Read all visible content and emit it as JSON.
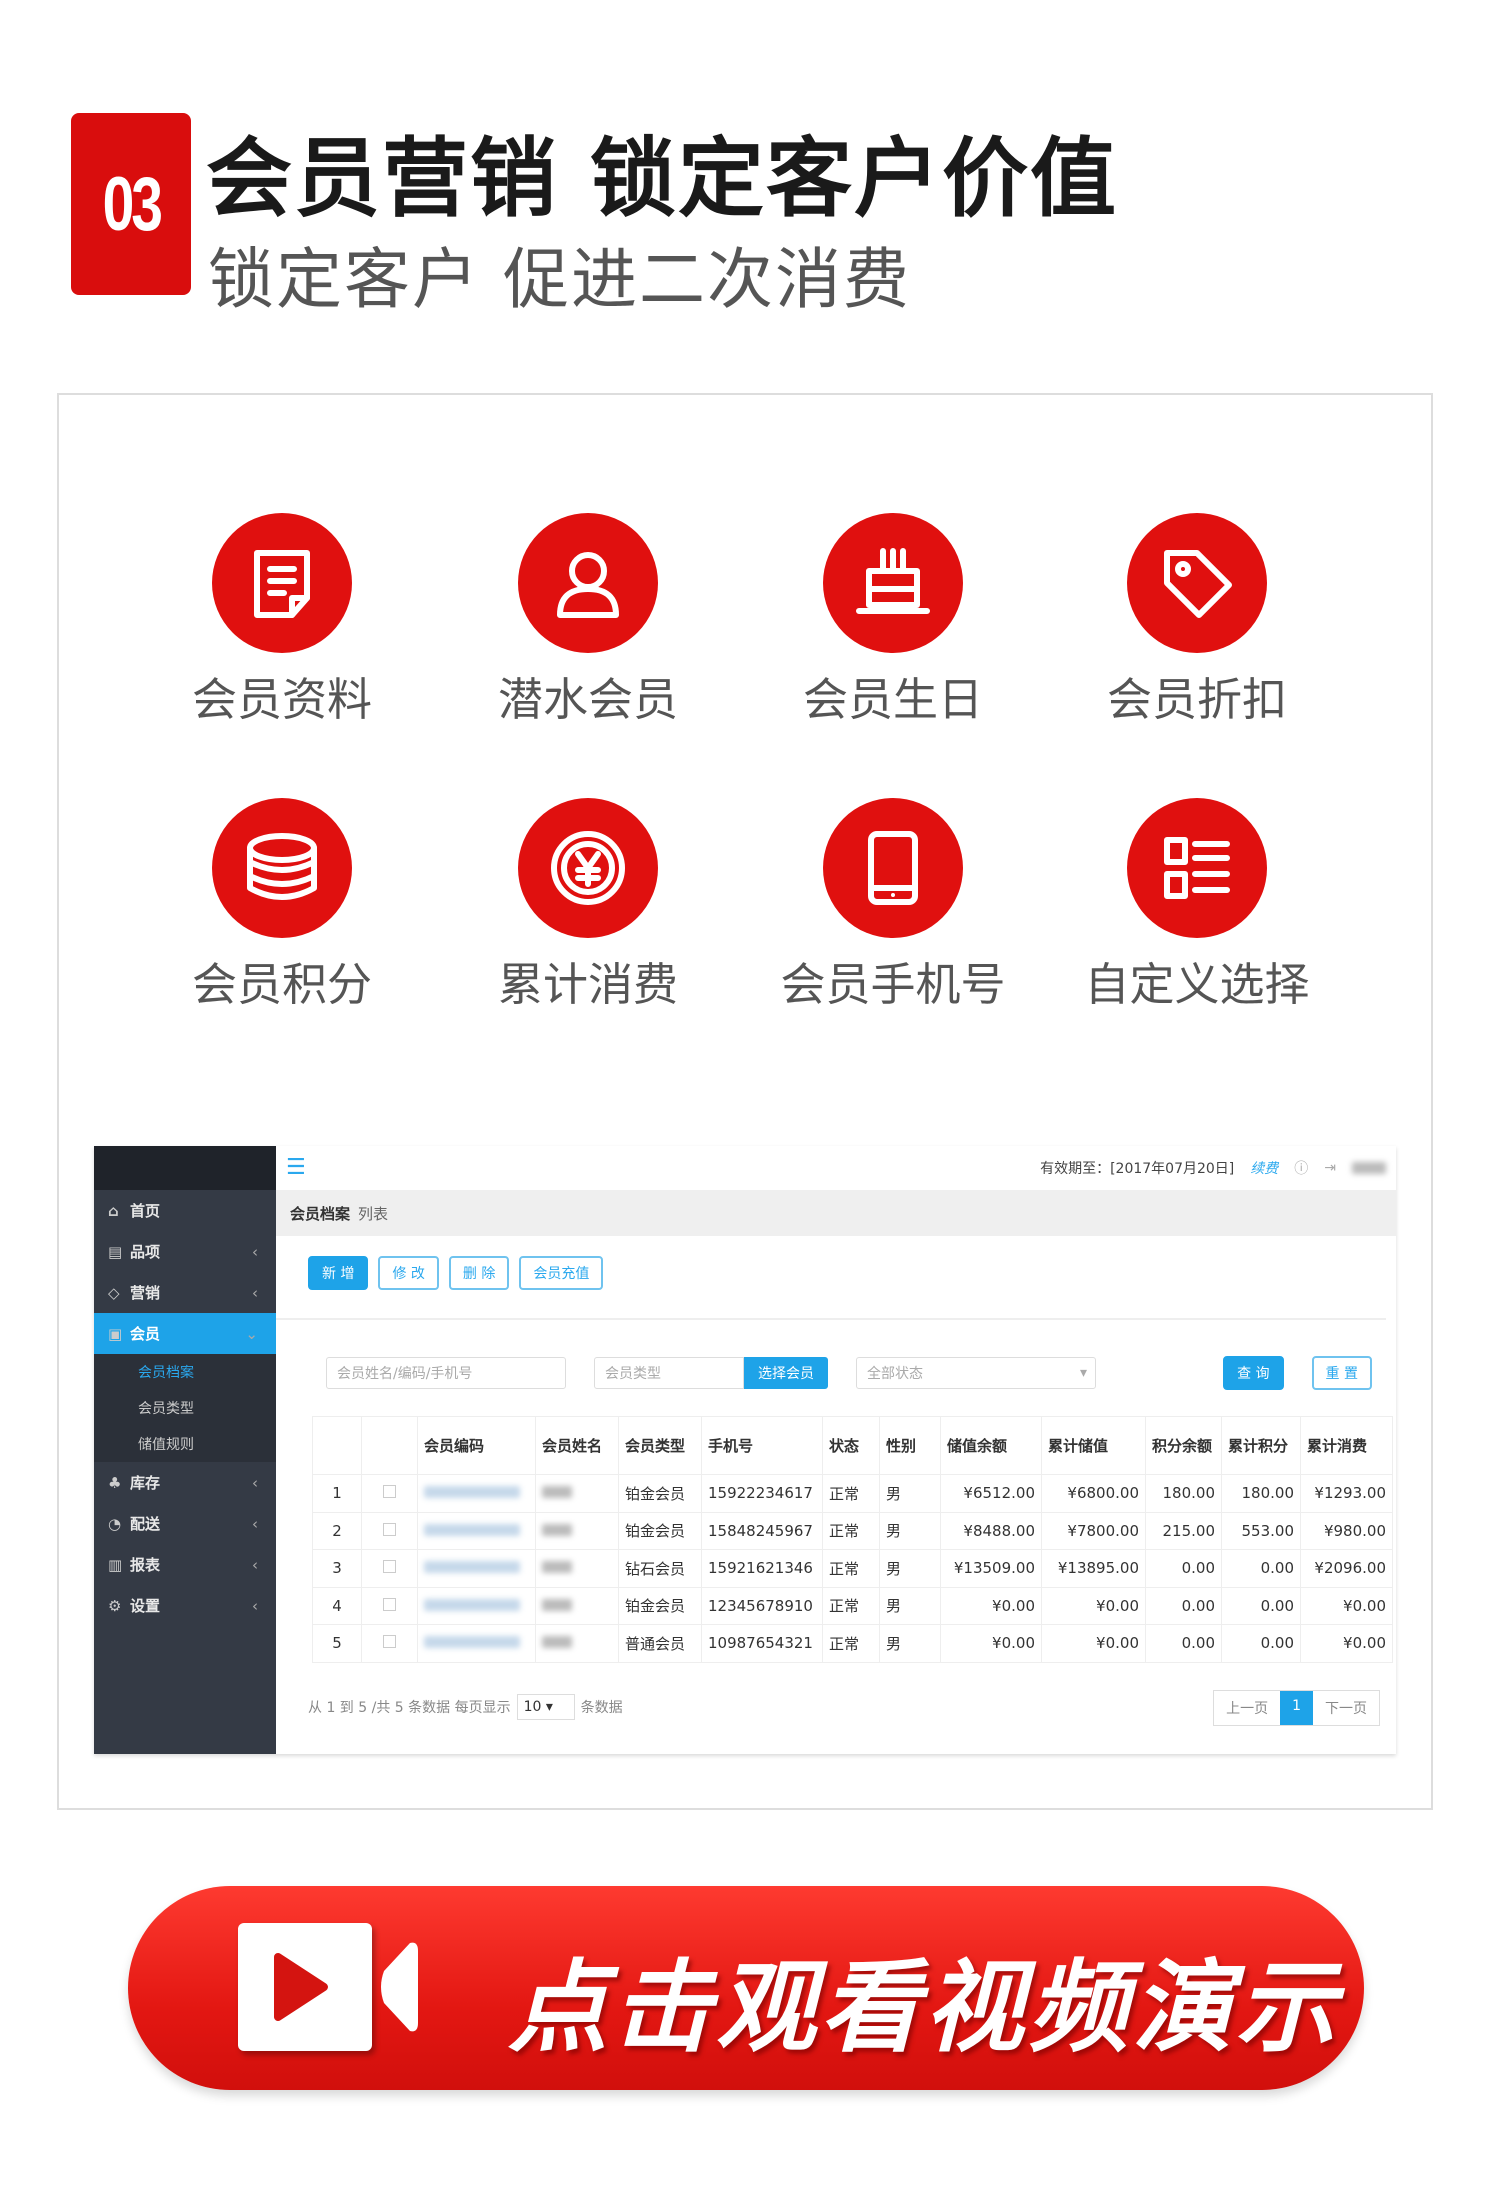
{
  "header": {
    "badge": "03",
    "title": "会员营销 锁定客户价值",
    "subtitle": "锁定客户 促进二次消费"
  },
  "features": [
    {
      "label": "会员资料",
      "icon": "document-icon"
    },
    {
      "label": "潜水会员",
      "icon": "user-icon"
    },
    {
      "label": "会员生日",
      "icon": "cake-icon"
    },
    {
      "label": "会员折扣",
      "icon": "tag-icon"
    },
    {
      "label": "会员积分",
      "icon": "coins-icon"
    },
    {
      "label": "累计消费",
      "icon": "yen-coin-icon"
    },
    {
      "label": "会员手机号",
      "icon": "phone-icon"
    },
    {
      "label": "自定义选择",
      "icon": "list-icon"
    }
  ],
  "app": {
    "sidebar": {
      "items": [
        {
          "label": "首页",
          "icon": "home-icon"
        },
        {
          "label": "品项",
          "icon": "box-icon"
        },
        {
          "label": "营销",
          "icon": "tag-icon"
        },
        {
          "label": "会员",
          "icon": "member-icon"
        },
        {
          "label": "库存",
          "icon": "stock-icon"
        },
        {
          "label": "配送",
          "icon": "delivery-icon"
        },
        {
          "label": "报表",
          "icon": "report-icon"
        },
        {
          "label": "设置",
          "icon": "gear-icon"
        }
      ],
      "subitems": [
        "会员档案",
        "会员类型",
        "储值规则"
      ]
    },
    "topbar": {
      "expiry": "有效期至：[2017年07月20日]",
      "renew": "续费"
    },
    "breadcrumb": {
      "title": "会员档案",
      "sub": "列表"
    },
    "buttons": {
      "add": "新 增",
      "edit": "修 改",
      "delete": "删 除",
      "recharge": "会员充值"
    },
    "search": {
      "keyword_placeholder": "会员姓名/编码/手机号",
      "type_placeholder": "会员类型",
      "select_member": "选择会员",
      "status": "全部状态",
      "query": "查 询",
      "reset": "重 置"
    },
    "table": {
      "headers": [
        "",
        "",
        "会员编码",
        "会员姓名",
        "会员类型",
        "手机号",
        "状态",
        "性别",
        "储值余额",
        "累计储值",
        "积分余额",
        "累计积分",
        "累计消费"
      ],
      "rows": [
        {
          "no": "1",
          "type": "铂金会员",
          "phone": "15922234617",
          "status": "正常",
          "gender": "男",
          "balance": "¥6512.00",
          "total_stored": "¥6800.00",
          "points": "180.00",
          "total_points": "180.00",
          "total_spent": "¥1293.00"
        },
        {
          "no": "2",
          "type": "铂金会员",
          "phone": "15848245967",
          "status": "正常",
          "gender": "男",
          "balance": "¥8488.00",
          "total_stored": "¥7800.00",
          "points": "215.00",
          "total_points": "553.00",
          "total_spent": "¥980.00"
        },
        {
          "no": "3",
          "type": "钻石会员",
          "phone": "15921621346",
          "status": "正常",
          "gender": "男",
          "balance": "¥13509.00",
          "total_stored": "¥13895.00",
          "points": "0.00",
          "total_points": "0.00",
          "total_spent": "¥2096.00"
        },
        {
          "no": "4",
          "type": "铂金会员",
          "phone": "12345678910",
          "status": "正常",
          "gender": "男",
          "balance": "¥0.00",
          "total_stored": "¥0.00",
          "points": "0.00",
          "total_points": "0.00",
          "total_spent": "¥0.00"
        },
        {
          "no": "5",
          "type": "普通会员",
          "phone": "10987654321",
          "status": "正常",
          "gender": "男",
          "balance": "¥0.00",
          "total_stored": "¥0.00",
          "points": "0.00",
          "total_points": "0.00",
          "total_spent": "¥0.00"
        }
      ]
    },
    "pager": {
      "info": "从 1 到 5 /共 5 条数据 每页显示",
      "page_size": "10",
      "suffix": "条数据",
      "prev": "上一页",
      "current": "1",
      "next": "下一页"
    }
  },
  "video_button": {
    "label": "点击观看视频演示"
  },
  "colors": {
    "brand_red": "#e0100f",
    "app_blue": "#1ea3e8",
    "sidebar": "#343a45"
  }
}
